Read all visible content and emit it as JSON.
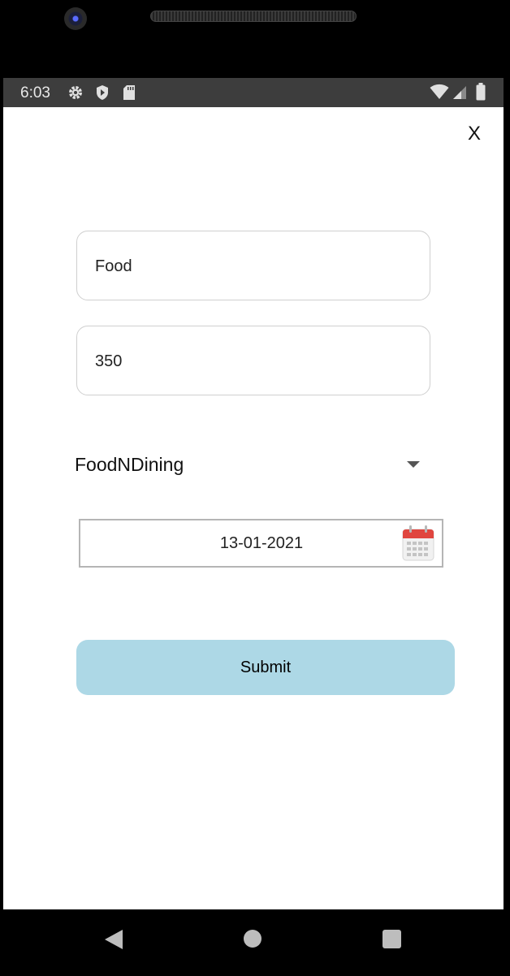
{
  "status_bar": {
    "time": "6:03",
    "left_icons": [
      "gear-icon",
      "shield-icon",
      "sd-card-icon"
    ],
    "right_icons": [
      "wifi-icon",
      "cell-signal-icon",
      "battery-icon"
    ]
  },
  "header": {
    "close_label": "X"
  },
  "form": {
    "title_value": "Food",
    "amount_value": "350",
    "category_selected": "FoodNDining",
    "date_value": "13-01-2021",
    "submit_label": "Submit"
  },
  "colors": {
    "submit_bg": "#add8e6",
    "status_bar_bg": "#3d3d3d",
    "calendar_red": "#e0463f"
  },
  "nav_bar": {
    "icons": [
      "back-icon",
      "home-icon",
      "recents-icon"
    ]
  }
}
